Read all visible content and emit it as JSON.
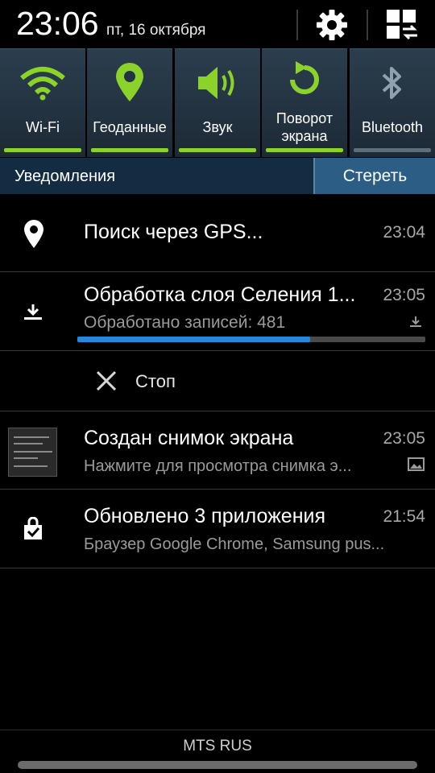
{
  "status": {
    "time": "23:06",
    "date": "пт, 16 октября"
  },
  "quick_settings": [
    {
      "label": "Wi-Fi",
      "icon": "wifi-icon",
      "active": true
    },
    {
      "label": "Геоданные",
      "icon": "location-icon",
      "active": true
    },
    {
      "label": "Звук",
      "icon": "sound-icon",
      "active": true
    },
    {
      "label": "Поворот\nэкрана",
      "icon": "rotate-icon",
      "active": true
    },
    {
      "label": "Bluetooth",
      "icon": "bluetooth-icon",
      "active": false
    }
  ],
  "colors": {
    "accent_green": "#8bd22a",
    "progress_blue": "#2a86d6",
    "header_bg": "#142c42"
  },
  "notifications": {
    "header": "Уведомления",
    "clear_label": "Стереть",
    "items": [
      {
        "icon": "location-pin-icon",
        "title": "Поиск через GPS...",
        "time": "23:04"
      },
      {
        "icon": "download-icon",
        "title": "Обработка слоя Селения 1...",
        "text": "Обработано записей: 481",
        "time": "23:05",
        "progress": 0.67,
        "right_icon": "download-small-icon"
      },
      {
        "icon": "close-icon",
        "title": "Стоп"
      },
      {
        "icon": "screenshot-thumbnail",
        "title": "Создан снимок экрана",
        "text": "Нажмите для просмотра снимка э...",
        "time": "23:05",
        "right_icon": "image-icon"
      },
      {
        "icon": "app-update-icon",
        "title": "Обновлено 3 приложения",
        "text": "Браузер Google Chrome, Samsung pus...",
        "time": "21:54"
      }
    ]
  },
  "carrier": "MTS RUS"
}
